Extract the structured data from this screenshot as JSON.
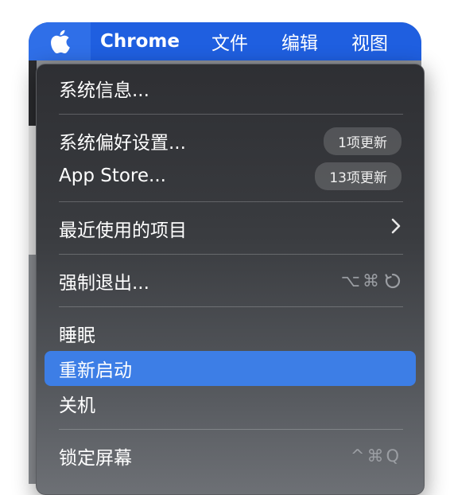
{
  "menubar": {
    "app_name": "Chrome",
    "items": [
      "文件",
      "编辑",
      "视图"
    ]
  },
  "apple_menu": {
    "items": {
      "about": "系统信息...",
      "prefs": "系统偏好设置...",
      "prefs_badge": "1项更新",
      "appstore": "App Store...",
      "appstore_badge": "13项更新",
      "recent": "最近使用的项目",
      "forcequit": "强制退出...",
      "forcequit_shortcut": "⌥⌘",
      "sleep": "睡眠",
      "restart": "重新启动",
      "shutdown": "关机",
      "lock": "锁定屏幕",
      "lock_shortcut": "^⌘Q"
    },
    "highlighted": "重新启动"
  },
  "icons": {
    "apple": "apple-icon",
    "submenu": "chevron-right-icon",
    "force_quit": "power-refresh-icon"
  },
  "colors": {
    "menubar": "#1f5fe0",
    "highlight": "#3d7ee6",
    "menu_bg": "#2e2f33"
  }
}
